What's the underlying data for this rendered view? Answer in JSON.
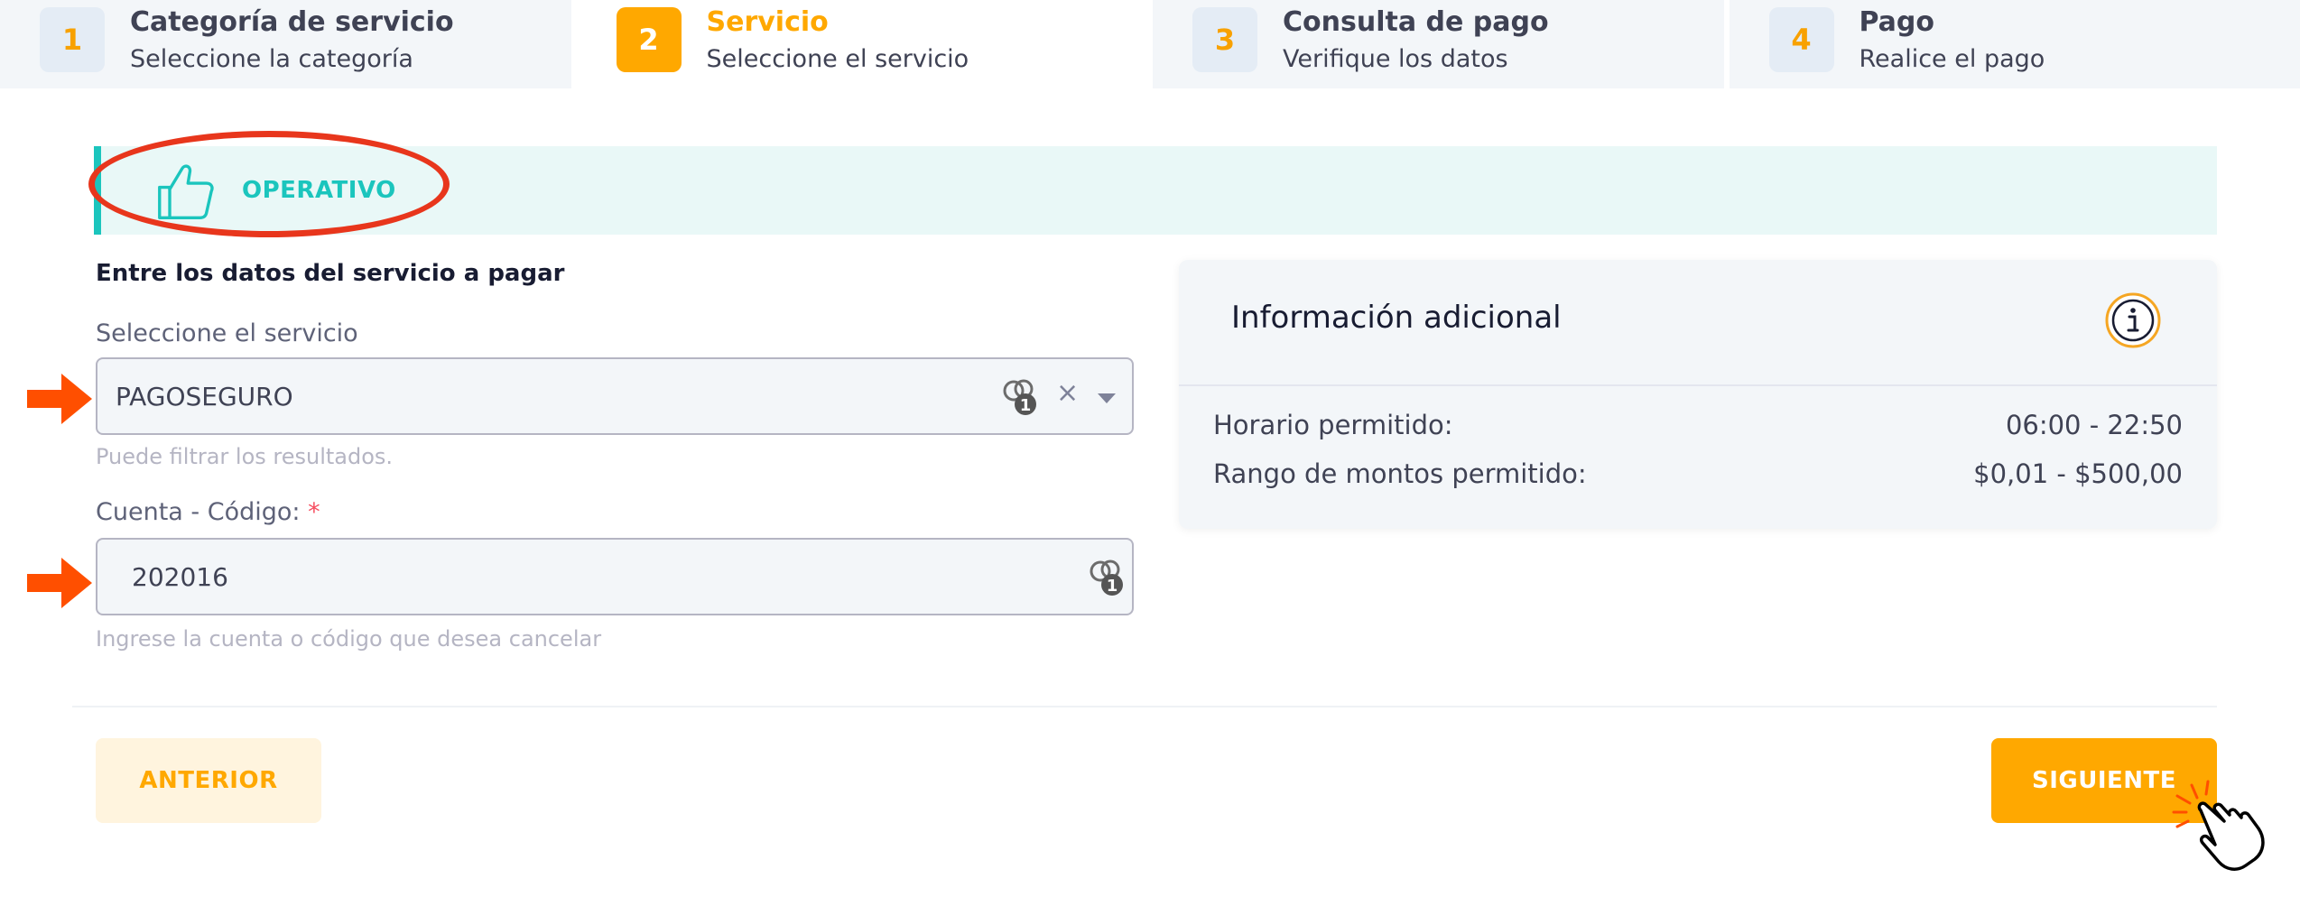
{
  "stepper": {
    "steps": [
      {
        "number": "1",
        "title": "Categoría de servicio",
        "subtitle": "Seleccione la categoría"
      },
      {
        "number": "2",
        "title": "Servicio",
        "subtitle": "Seleccione el servicio"
      },
      {
        "number": "3",
        "title": "Consulta de pago",
        "subtitle": "Verifique los datos"
      },
      {
        "number": "4",
        "title": "Pago",
        "subtitle": "Realice el pago"
      }
    ],
    "active_step": 2
  },
  "status": {
    "label": "OPERATIVO",
    "icon": "thumbs-up-icon",
    "color": "#1bc5bd"
  },
  "form": {
    "heading": "Entre los datos del servicio a pagar",
    "service": {
      "label": "Seleccione el servicio",
      "value": "PAGOSEGURO",
      "clear": "×",
      "hint": "Puede filtrar los resultados."
    },
    "account": {
      "label": "Cuenta - Código:",
      "required_mark": "*",
      "value": "202016",
      "hint": "Ingrese la cuenta o código que desea cancelar"
    }
  },
  "info": {
    "title": "Información adicional",
    "rows": [
      {
        "label": "Horario permitido:",
        "value": "06:00 - 22:50"
      },
      {
        "label": "Rango de montos permitido:",
        "value": "$0,01 - $500,00"
      }
    ]
  },
  "footer": {
    "prev_label": "ANTERIOR",
    "next_label": "SIGUIENTE"
  },
  "colors": {
    "accent": "#ffa800",
    "success": "#1bc5bd",
    "annotation": "#e8361c",
    "arrow": "#ff4f00"
  }
}
